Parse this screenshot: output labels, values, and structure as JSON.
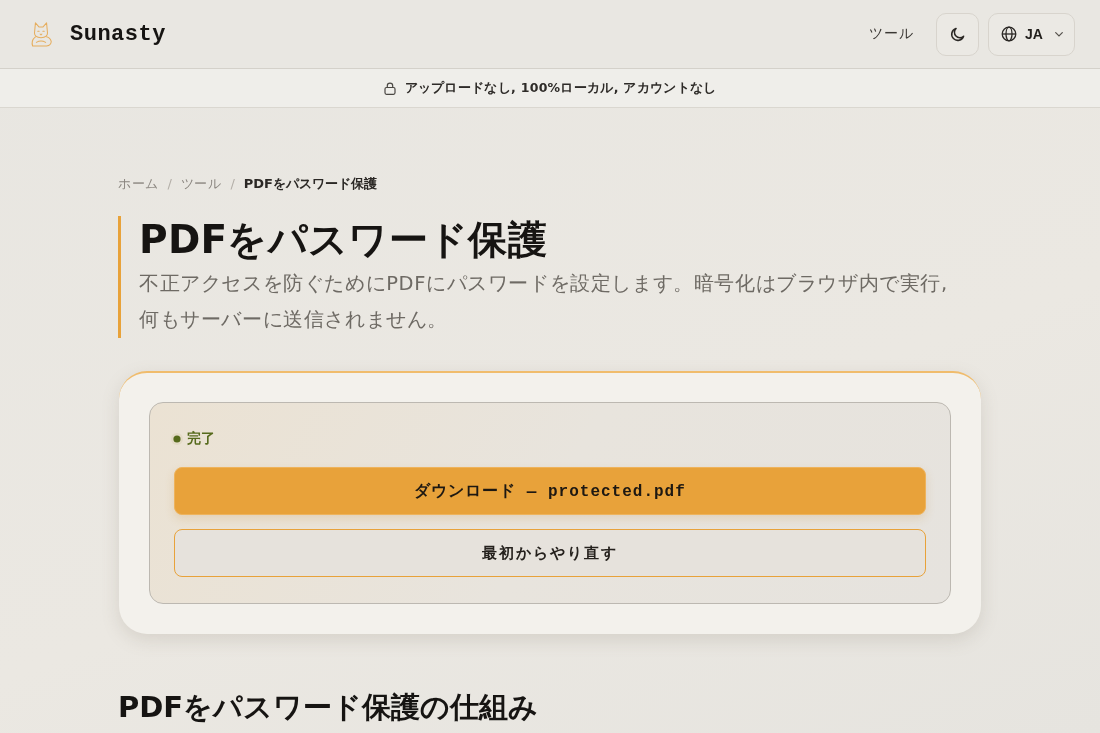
{
  "header": {
    "brand": "Sunasty",
    "nav": [
      {
        "label": "ツール"
      }
    ],
    "language": "JA"
  },
  "banner": {
    "text": "アップロードなし, 100%ローカル, アカウントなし"
  },
  "breadcrumb": {
    "items": [
      {
        "label": "ホーム",
        "current": false
      },
      {
        "label": "ツール",
        "current": false
      },
      {
        "label": "PDFをパスワード保護",
        "current": true
      }
    ],
    "separators": [
      "/",
      "/"
    ]
  },
  "page": {
    "title": "PDFをパスワード保護",
    "description": "不正アクセスを防ぐためにPDFにパスワードを設定します。暗号化はブラウザ内で実行, 何もサーバーに送信されません。"
  },
  "result": {
    "status": {
      "label": "完了",
      "kind": "success"
    },
    "actions": [
      {
        "label": "ダウンロード — protected.pdf",
        "kind": "primary"
      },
      {
        "label": "最初からやり直す",
        "kind": "secondary"
      }
    ]
  },
  "section": {
    "heading": "PDFをパスワード保護の仕組み"
  }
}
